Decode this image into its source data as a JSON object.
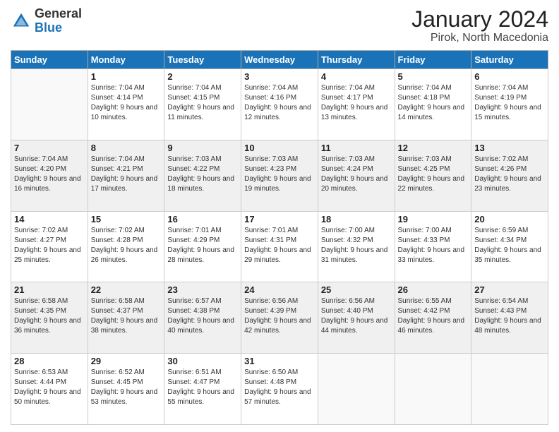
{
  "header": {
    "logo_general": "General",
    "logo_blue": "Blue",
    "month_title": "January 2024",
    "location": "Pirok, North Macedonia"
  },
  "days_of_week": [
    "Sunday",
    "Monday",
    "Tuesday",
    "Wednesday",
    "Thursday",
    "Friday",
    "Saturday"
  ],
  "weeks": [
    [
      {
        "day": "",
        "sunrise": "",
        "sunset": "",
        "daylight": ""
      },
      {
        "day": "1",
        "sunrise": "Sunrise: 7:04 AM",
        "sunset": "Sunset: 4:14 PM",
        "daylight": "Daylight: 9 hours and 10 minutes."
      },
      {
        "day": "2",
        "sunrise": "Sunrise: 7:04 AM",
        "sunset": "Sunset: 4:15 PM",
        "daylight": "Daylight: 9 hours and 11 minutes."
      },
      {
        "day": "3",
        "sunrise": "Sunrise: 7:04 AM",
        "sunset": "Sunset: 4:16 PM",
        "daylight": "Daylight: 9 hours and 12 minutes."
      },
      {
        "day": "4",
        "sunrise": "Sunrise: 7:04 AM",
        "sunset": "Sunset: 4:17 PM",
        "daylight": "Daylight: 9 hours and 13 minutes."
      },
      {
        "day": "5",
        "sunrise": "Sunrise: 7:04 AM",
        "sunset": "Sunset: 4:18 PM",
        "daylight": "Daylight: 9 hours and 14 minutes."
      },
      {
        "day": "6",
        "sunrise": "Sunrise: 7:04 AM",
        "sunset": "Sunset: 4:19 PM",
        "daylight": "Daylight: 9 hours and 15 minutes."
      }
    ],
    [
      {
        "day": "7",
        "sunrise": "Sunrise: 7:04 AM",
        "sunset": "Sunset: 4:20 PM",
        "daylight": "Daylight: 9 hours and 16 minutes."
      },
      {
        "day": "8",
        "sunrise": "Sunrise: 7:04 AM",
        "sunset": "Sunset: 4:21 PM",
        "daylight": "Daylight: 9 hours and 17 minutes."
      },
      {
        "day": "9",
        "sunrise": "Sunrise: 7:03 AM",
        "sunset": "Sunset: 4:22 PM",
        "daylight": "Daylight: 9 hours and 18 minutes."
      },
      {
        "day": "10",
        "sunrise": "Sunrise: 7:03 AM",
        "sunset": "Sunset: 4:23 PM",
        "daylight": "Daylight: 9 hours and 19 minutes."
      },
      {
        "day": "11",
        "sunrise": "Sunrise: 7:03 AM",
        "sunset": "Sunset: 4:24 PM",
        "daylight": "Daylight: 9 hours and 20 minutes."
      },
      {
        "day": "12",
        "sunrise": "Sunrise: 7:03 AM",
        "sunset": "Sunset: 4:25 PM",
        "daylight": "Daylight: 9 hours and 22 minutes."
      },
      {
        "day": "13",
        "sunrise": "Sunrise: 7:02 AM",
        "sunset": "Sunset: 4:26 PM",
        "daylight": "Daylight: 9 hours and 23 minutes."
      }
    ],
    [
      {
        "day": "14",
        "sunrise": "Sunrise: 7:02 AM",
        "sunset": "Sunset: 4:27 PM",
        "daylight": "Daylight: 9 hours and 25 minutes."
      },
      {
        "day": "15",
        "sunrise": "Sunrise: 7:02 AM",
        "sunset": "Sunset: 4:28 PM",
        "daylight": "Daylight: 9 hours and 26 minutes."
      },
      {
        "day": "16",
        "sunrise": "Sunrise: 7:01 AM",
        "sunset": "Sunset: 4:29 PM",
        "daylight": "Daylight: 9 hours and 28 minutes."
      },
      {
        "day": "17",
        "sunrise": "Sunrise: 7:01 AM",
        "sunset": "Sunset: 4:31 PM",
        "daylight": "Daylight: 9 hours and 29 minutes."
      },
      {
        "day": "18",
        "sunrise": "Sunrise: 7:00 AM",
        "sunset": "Sunset: 4:32 PM",
        "daylight": "Daylight: 9 hours and 31 minutes."
      },
      {
        "day": "19",
        "sunrise": "Sunrise: 7:00 AM",
        "sunset": "Sunset: 4:33 PM",
        "daylight": "Daylight: 9 hours and 33 minutes."
      },
      {
        "day": "20",
        "sunrise": "Sunrise: 6:59 AM",
        "sunset": "Sunset: 4:34 PM",
        "daylight": "Daylight: 9 hours and 35 minutes."
      }
    ],
    [
      {
        "day": "21",
        "sunrise": "Sunrise: 6:58 AM",
        "sunset": "Sunset: 4:35 PM",
        "daylight": "Daylight: 9 hours and 36 minutes."
      },
      {
        "day": "22",
        "sunrise": "Sunrise: 6:58 AM",
        "sunset": "Sunset: 4:37 PM",
        "daylight": "Daylight: 9 hours and 38 minutes."
      },
      {
        "day": "23",
        "sunrise": "Sunrise: 6:57 AM",
        "sunset": "Sunset: 4:38 PM",
        "daylight": "Daylight: 9 hours and 40 minutes."
      },
      {
        "day": "24",
        "sunrise": "Sunrise: 6:56 AM",
        "sunset": "Sunset: 4:39 PM",
        "daylight": "Daylight: 9 hours and 42 minutes."
      },
      {
        "day": "25",
        "sunrise": "Sunrise: 6:56 AM",
        "sunset": "Sunset: 4:40 PM",
        "daylight": "Daylight: 9 hours and 44 minutes."
      },
      {
        "day": "26",
        "sunrise": "Sunrise: 6:55 AM",
        "sunset": "Sunset: 4:42 PM",
        "daylight": "Daylight: 9 hours and 46 minutes."
      },
      {
        "day": "27",
        "sunrise": "Sunrise: 6:54 AM",
        "sunset": "Sunset: 4:43 PM",
        "daylight": "Daylight: 9 hours and 48 minutes."
      }
    ],
    [
      {
        "day": "28",
        "sunrise": "Sunrise: 6:53 AM",
        "sunset": "Sunset: 4:44 PM",
        "daylight": "Daylight: 9 hours and 50 minutes."
      },
      {
        "day": "29",
        "sunrise": "Sunrise: 6:52 AM",
        "sunset": "Sunset: 4:45 PM",
        "daylight": "Daylight: 9 hours and 53 minutes."
      },
      {
        "day": "30",
        "sunrise": "Sunrise: 6:51 AM",
        "sunset": "Sunset: 4:47 PM",
        "daylight": "Daylight: 9 hours and 55 minutes."
      },
      {
        "day": "31",
        "sunrise": "Sunrise: 6:50 AM",
        "sunset": "Sunset: 4:48 PM",
        "daylight": "Daylight: 9 hours and 57 minutes."
      },
      {
        "day": "",
        "sunrise": "",
        "sunset": "",
        "daylight": ""
      },
      {
        "day": "",
        "sunrise": "",
        "sunset": "",
        "daylight": ""
      },
      {
        "day": "",
        "sunrise": "",
        "sunset": "",
        "daylight": ""
      }
    ]
  ]
}
